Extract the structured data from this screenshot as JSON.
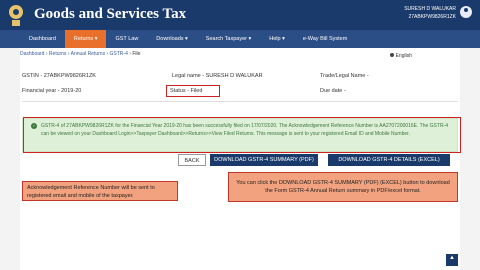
{
  "header": {
    "title": "Goods and Services Tax",
    "user_name": "SURESH D WALUKAR",
    "user_gstin": "27ABKPW9826R1ZK"
  },
  "nav": {
    "items": [
      {
        "label": "Dashboard"
      },
      {
        "label": "Returns ▾"
      },
      {
        "label": "GST Law"
      },
      {
        "label": "Downloads ▾"
      },
      {
        "label": "Search Taxpayer ▾"
      },
      {
        "label": "Help ▾"
      },
      {
        "label": "e-Way Bill System"
      }
    ]
  },
  "breadcrumb": {
    "items": [
      "Dashboard",
      "Returns",
      "Annual Returns",
      "GSTR-4"
    ],
    "current": "File"
  },
  "language": "English",
  "info": {
    "gstin": "GSTIN - 27ABKPW9826R1ZK",
    "legal_name": "Legal name - SURESH D WALUKAR",
    "trade_name": "Trade/Legal Name -",
    "fy": "Financial year - 2019-20",
    "status": "Status - Filed",
    "due_date": "Due date -"
  },
  "alert": {
    "message": "GSTR-4 of 27ABKPW9826R1ZK for the Financial Year 2019-20 has been successfully filed on 17/07/2020. The Acknowledgement Reference Number is AA2707200016E. The GSTR-4 can be viewed on your Dashboard Login>>Taxpayer Dashboard>>Returns>>View Filed Returns. This message is sent to your registered Email ID and Mobile Number."
  },
  "buttons": {
    "back": "BACK",
    "summary": "DOWNLOAD GSTR-4 SUMMARY (PDF)",
    "details": "DOWNLOAD GSTR-4 DETAILS (EXCEL)"
  },
  "callouts": {
    "left": "Acknowledgement Reference Number will be sent to registered email and mobile of the taxpayer.",
    "right": "You can click the DOWNLOAD GSTR-4 SUMMARY (PDF) (EXCEL) button to download the Form GSTR-4 Annual Return summary in PDF/excel format."
  },
  "colors": {
    "header_bg": "#1a3a6b",
    "nav_bg": "#2c4e86",
    "active_tab": "#e8702a",
    "alert_bg": "#dff0d8",
    "callout_bg": "#f2a27e"
  }
}
